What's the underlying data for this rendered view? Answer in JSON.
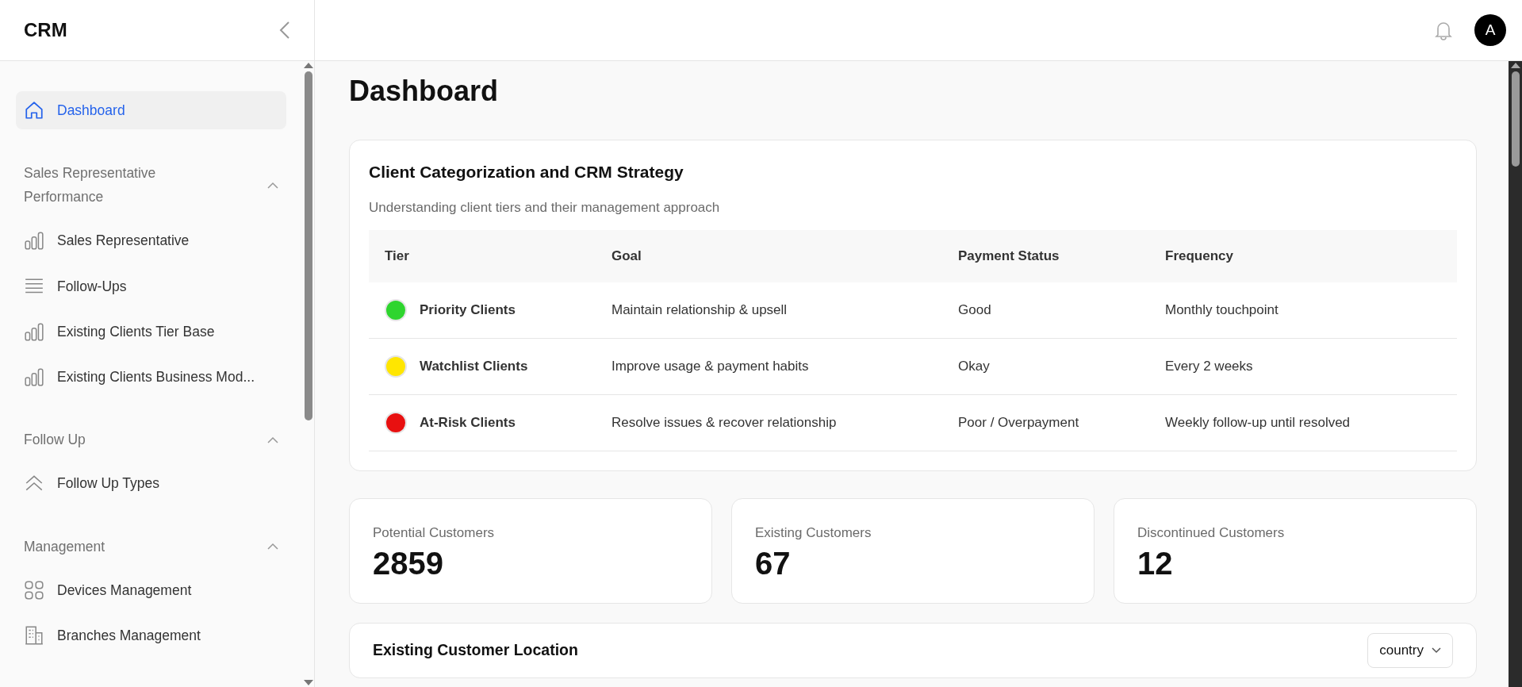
{
  "app": {
    "logo": "CRM"
  },
  "header": {
    "avatar": "A"
  },
  "sidebar": {
    "items": [
      {
        "label": "Dashboard",
        "kind": "home",
        "selected": true
      }
    ],
    "sections": [
      {
        "title": "Sales Representative Performance",
        "expanded": true,
        "items": [
          {
            "label": "Sales Representative",
            "kind": "bars",
            "selected": false
          },
          {
            "label": "Follow-Ups",
            "kind": "lines",
            "selected": false
          },
          {
            "label": "Existing Clients Tier Base",
            "kind": "bars",
            "selected": false
          },
          {
            "label": "Existing Clients Business Mod...",
            "kind": "bars",
            "selected": false
          }
        ]
      },
      {
        "title": "Follow Up",
        "expanded": true,
        "items": [
          {
            "label": "Follow Up Types",
            "kind": "chevrons",
            "selected": false
          }
        ]
      },
      {
        "title": "Management",
        "expanded": true,
        "items": [
          {
            "label": "Devices Management",
            "kind": "grid",
            "selected": false
          },
          {
            "label": "Branches Management",
            "kind": "building",
            "selected": false
          }
        ]
      }
    ]
  },
  "page": {
    "title": "Dashboard"
  },
  "strategy": {
    "title": "Client Categorization and CRM Strategy",
    "subtitle": "Understanding client tiers and their management approach",
    "columns": [
      "Tier",
      "Goal",
      "Payment Status",
      "Frequency"
    ],
    "rows": [
      {
        "tier": "Priority Clients",
        "color": "#2ed52e",
        "goal": "Maintain relationship & upsell",
        "payment": "Good",
        "frequency": "Monthly touchpoint"
      },
      {
        "tier": "Watchlist Clients",
        "color": "#ffe600",
        "goal": "Improve usage & payment habits",
        "payment": "Okay",
        "frequency": "Every 2 weeks"
      },
      {
        "tier": "At-Risk Clients",
        "color": "#e81010",
        "goal": "Resolve issues & recover relationship",
        "payment": "Poor / Overpayment",
        "frequency": "Weekly follow-up until resolved"
      }
    ]
  },
  "stats": [
    {
      "label": "Potential Customers",
      "value": "2859"
    },
    {
      "label": "Existing Customers",
      "value": "67"
    },
    {
      "label": "Discontinued Customers",
      "value": "12"
    }
  ],
  "location": {
    "title": "Existing Customer Location",
    "filter": "country"
  }
}
